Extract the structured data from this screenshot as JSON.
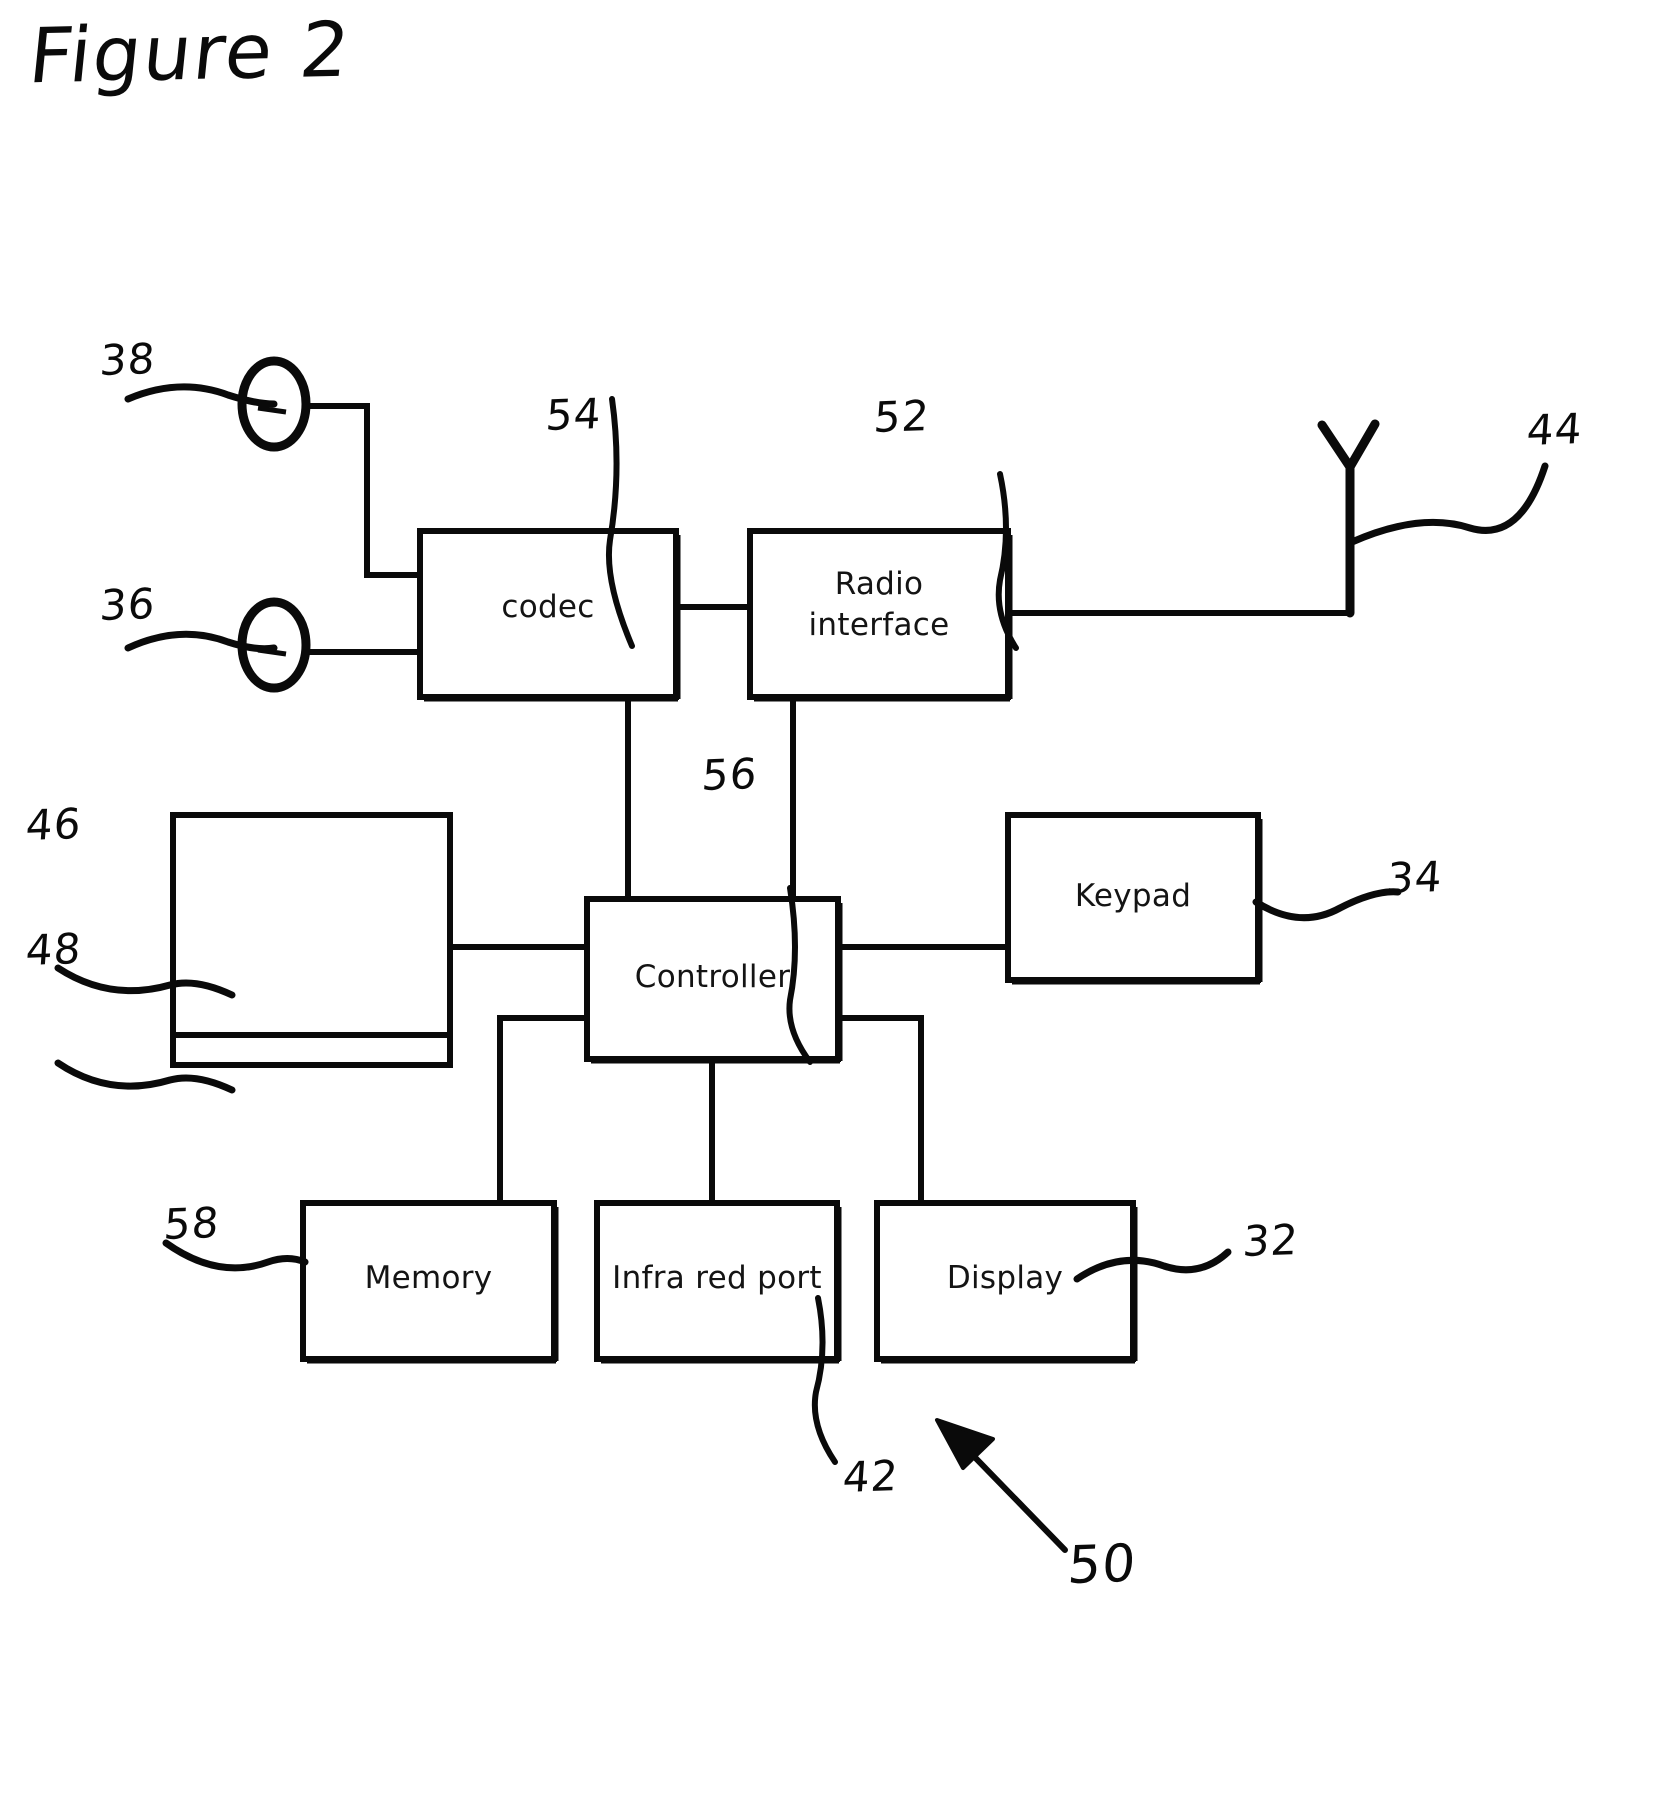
{
  "figure": {
    "title": "Figure 2",
    "type": "patent-block-diagram",
    "overall_ref": "50"
  },
  "blocks": [
    {
      "id": "codec",
      "label": "codec",
      "ref": "54"
    },
    {
      "id": "radio-interface",
      "label": "Radio\ninterface",
      "ref": "52"
    },
    {
      "id": "controller",
      "label": "Controller",
      "ref": "56"
    },
    {
      "id": "keypad",
      "label": "Keypad",
      "ref": "34"
    },
    {
      "id": "memory",
      "label": "Memory",
      "ref": "58"
    },
    {
      "id": "infra-red-port",
      "label": "Infra red port",
      "ref": "42"
    },
    {
      "id": "display",
      "label": "Display",
      "ref": "32"
    }
  ],
  "block_text": {
    "codec": "codec",
    "radio_interface_line1": "Radio",
    "radio_interface_line2": "interface",
    "controller": "Controller",
    "keypad": "Keypad",
    "memory": "Memory",
    "infra_red_port": "Infra red port",
    "display": "Display"
  },
  "components": [
    {
      "id": "speaker",
      "ref": "38",
      "shape": "ellipse"
    },
    {
      "id": "microphone",
      "ref": "36",
      "shape": "ellipse"
    },
    {
      "id": "antenna",
      "ref": "44",
      "shape": "y-antenna"
    },
    {
      "id": "smartcard-upper",
      "ref": "46",
      "shape": "split-box-top"
    },
    {
      "id": "smartcard-lower",
      "ref": "48",
      "shape": "split-box-bottom"
    }
  ],
  "reference_numerals": {
    "speaker": "38",
    "microphone": "36",
    "codec": "54",
    "radio_interface": "52",
    "antenna": "44",
    "smartcard_upper": "46",
    "smartcard_lower": "48",
    "controller": "56",
    "keypad": "34",
    "memory": "58",
    "infra_red_port": "42",
    "display": "32",
    "device_overall": "50"
  },
  "colors": {
    "ink": "#0a0a0a",
    "paper": "#ffffff"
  }
}
